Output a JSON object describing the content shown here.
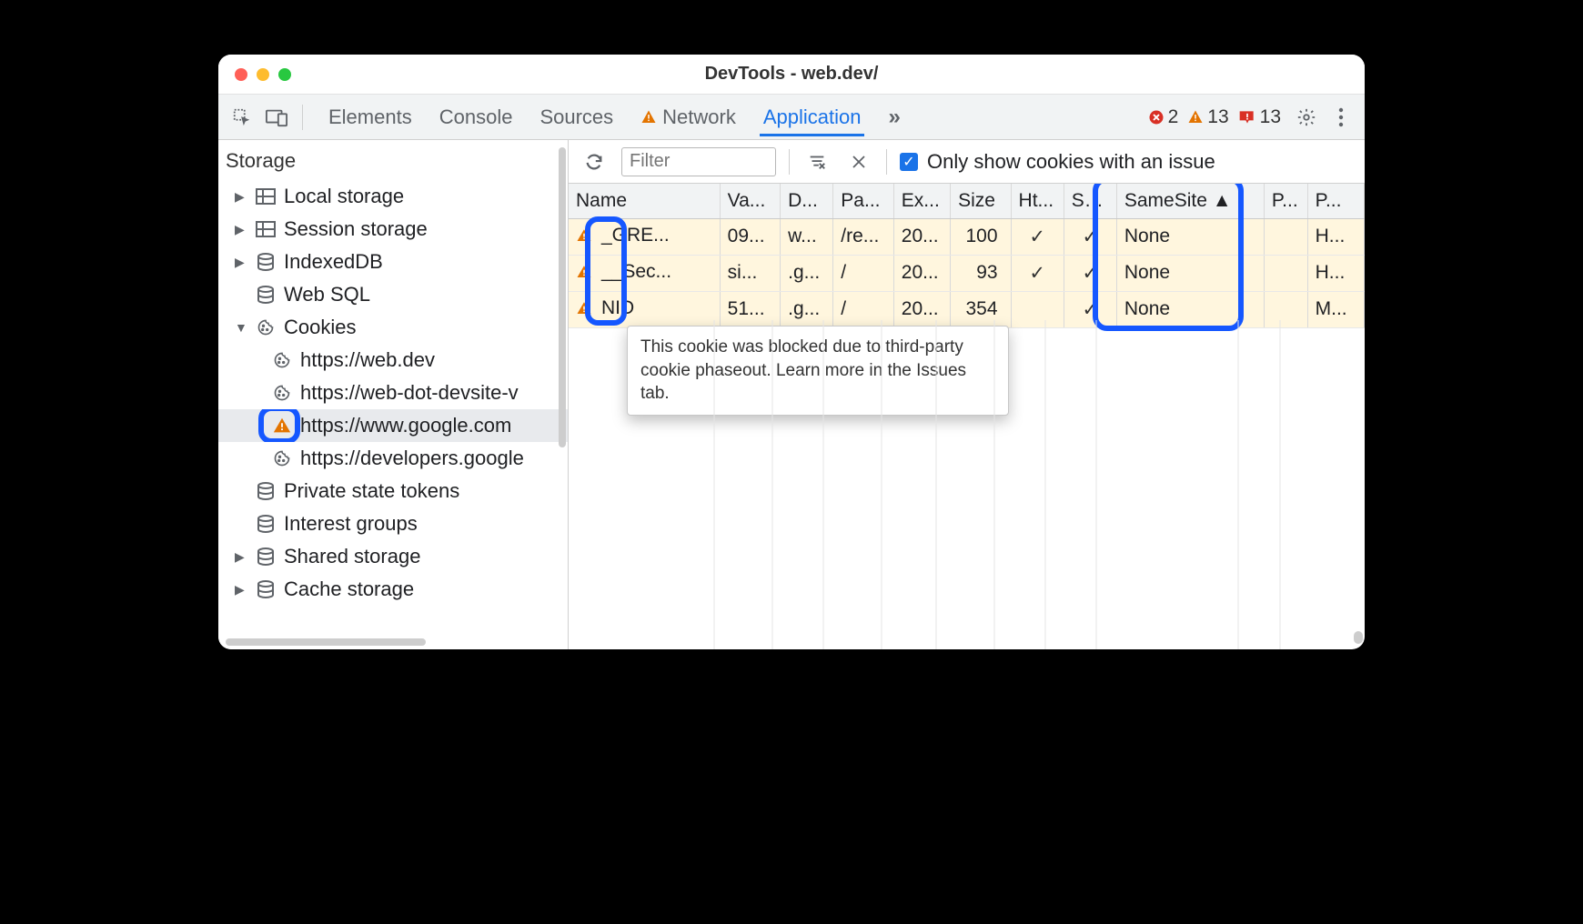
{
  "window_title": "DevTools - web.dev/",
  "tabs": {
    "elements": "Elements",
    "console": "Console",
    "sources": "Sources",
    "network": "Network",
    "application": "Application"
  },
  "status": {
    "errors": "2",
    "warnings": "13",
    "issues": "13"
  },
  "sidebar": {
    "section": "Storage",
    "items": [
      {
        "label": "Local storage",
        "icon": "db-grid",
        "chev": "▶"
      },
      {
        "label": "Session storage",
        "icon": "db-grid",
        "chev": "▶"
      },
      {
        "label": "IndexedDB",
        "icon": "db",
        "chev": "▶"
      },
      {
        "label": "Web SQL",
        "icon": "db",
        "chev": ""
      },
      {
        "label": "Cookies",
        "icon": "cookie",
        "chev": "▼"
      },
      {
        "label": "Private state tokens",
        "icon": "db",
        "chev": ""
      },
      {
        "label": "Interest groups",
        "icon": "db",
        "chev": ""
      },
      {
        "label": "Shared storage",
        "icon": "db",
        "chev": "▶"
      },
      {
        "label": "Cache storage",
        "icon": "db",
        "chev": "▶"
      }
    ],
    "cookie_children": [
      {
        "label": "https://web.dev",
        "icon": "cookie"
      },
      {
        "label": "https://web-dot-devsite-v",
        "icon": "cookie"
      },
      {
        "label": "https://www.google.com",
        "icon": "warn",
        "selected": true
      },
      {
        "label": "https://developers.google",
        "icon": "cookie"
      }
    ]
  },
  "filter": {
    "placeholder": "Filter",
    "only_issues_label": "Only show cookies with an issue",
    "only_issues_checked": true
  },
  "table": {
    "headers": [
      "Name",
      "Va...",
      "D...",
      "Pa...",
      "Ex...",
      "Size",
      "Ht...",
      "Se...",
      "SameSite",
      "P...",
      "P..."
    ],
    "sort_col": "SameSite",
    "sort_dir": "▲",
    "rows": [
      {
        "warn": true,
        "name": "_GRE...",
        "value": "09...",
        "domain": "w...",
        "path": "/re...",
        "expires": "20...",
        "size": "100",
        "http": "✓",
        "secure": "✓",
        "samesite": "None",
        "p1": "",
        "p2": "H..."
      },
      {
        "warn": true,
        "name": "__Sec...",
        "value": "si...",
        "domain": ".g...",
        "path": "/",
        "expires": "20...",
        "size": "93",
        "http": "✓",
        "secure": "✓",
        "samesite": "None",
        "p1": "",
        "p2": "H..."
      },
      {
        "warn": true,
        "name": "NID",
        "value": "51...",
        "domain": ".g...",
        "path": "/",
        "expires": "20...",
        "size": "354",
        "http": "",
        "secure": "✓",
        "samesite": "None",
        "p1": "",
        "p2": "M..."
      }
    ]
  },
  "tooltip": "This cookie was blocked due to third-party cookie phaseout. Learn more in the Issues tab."
}
